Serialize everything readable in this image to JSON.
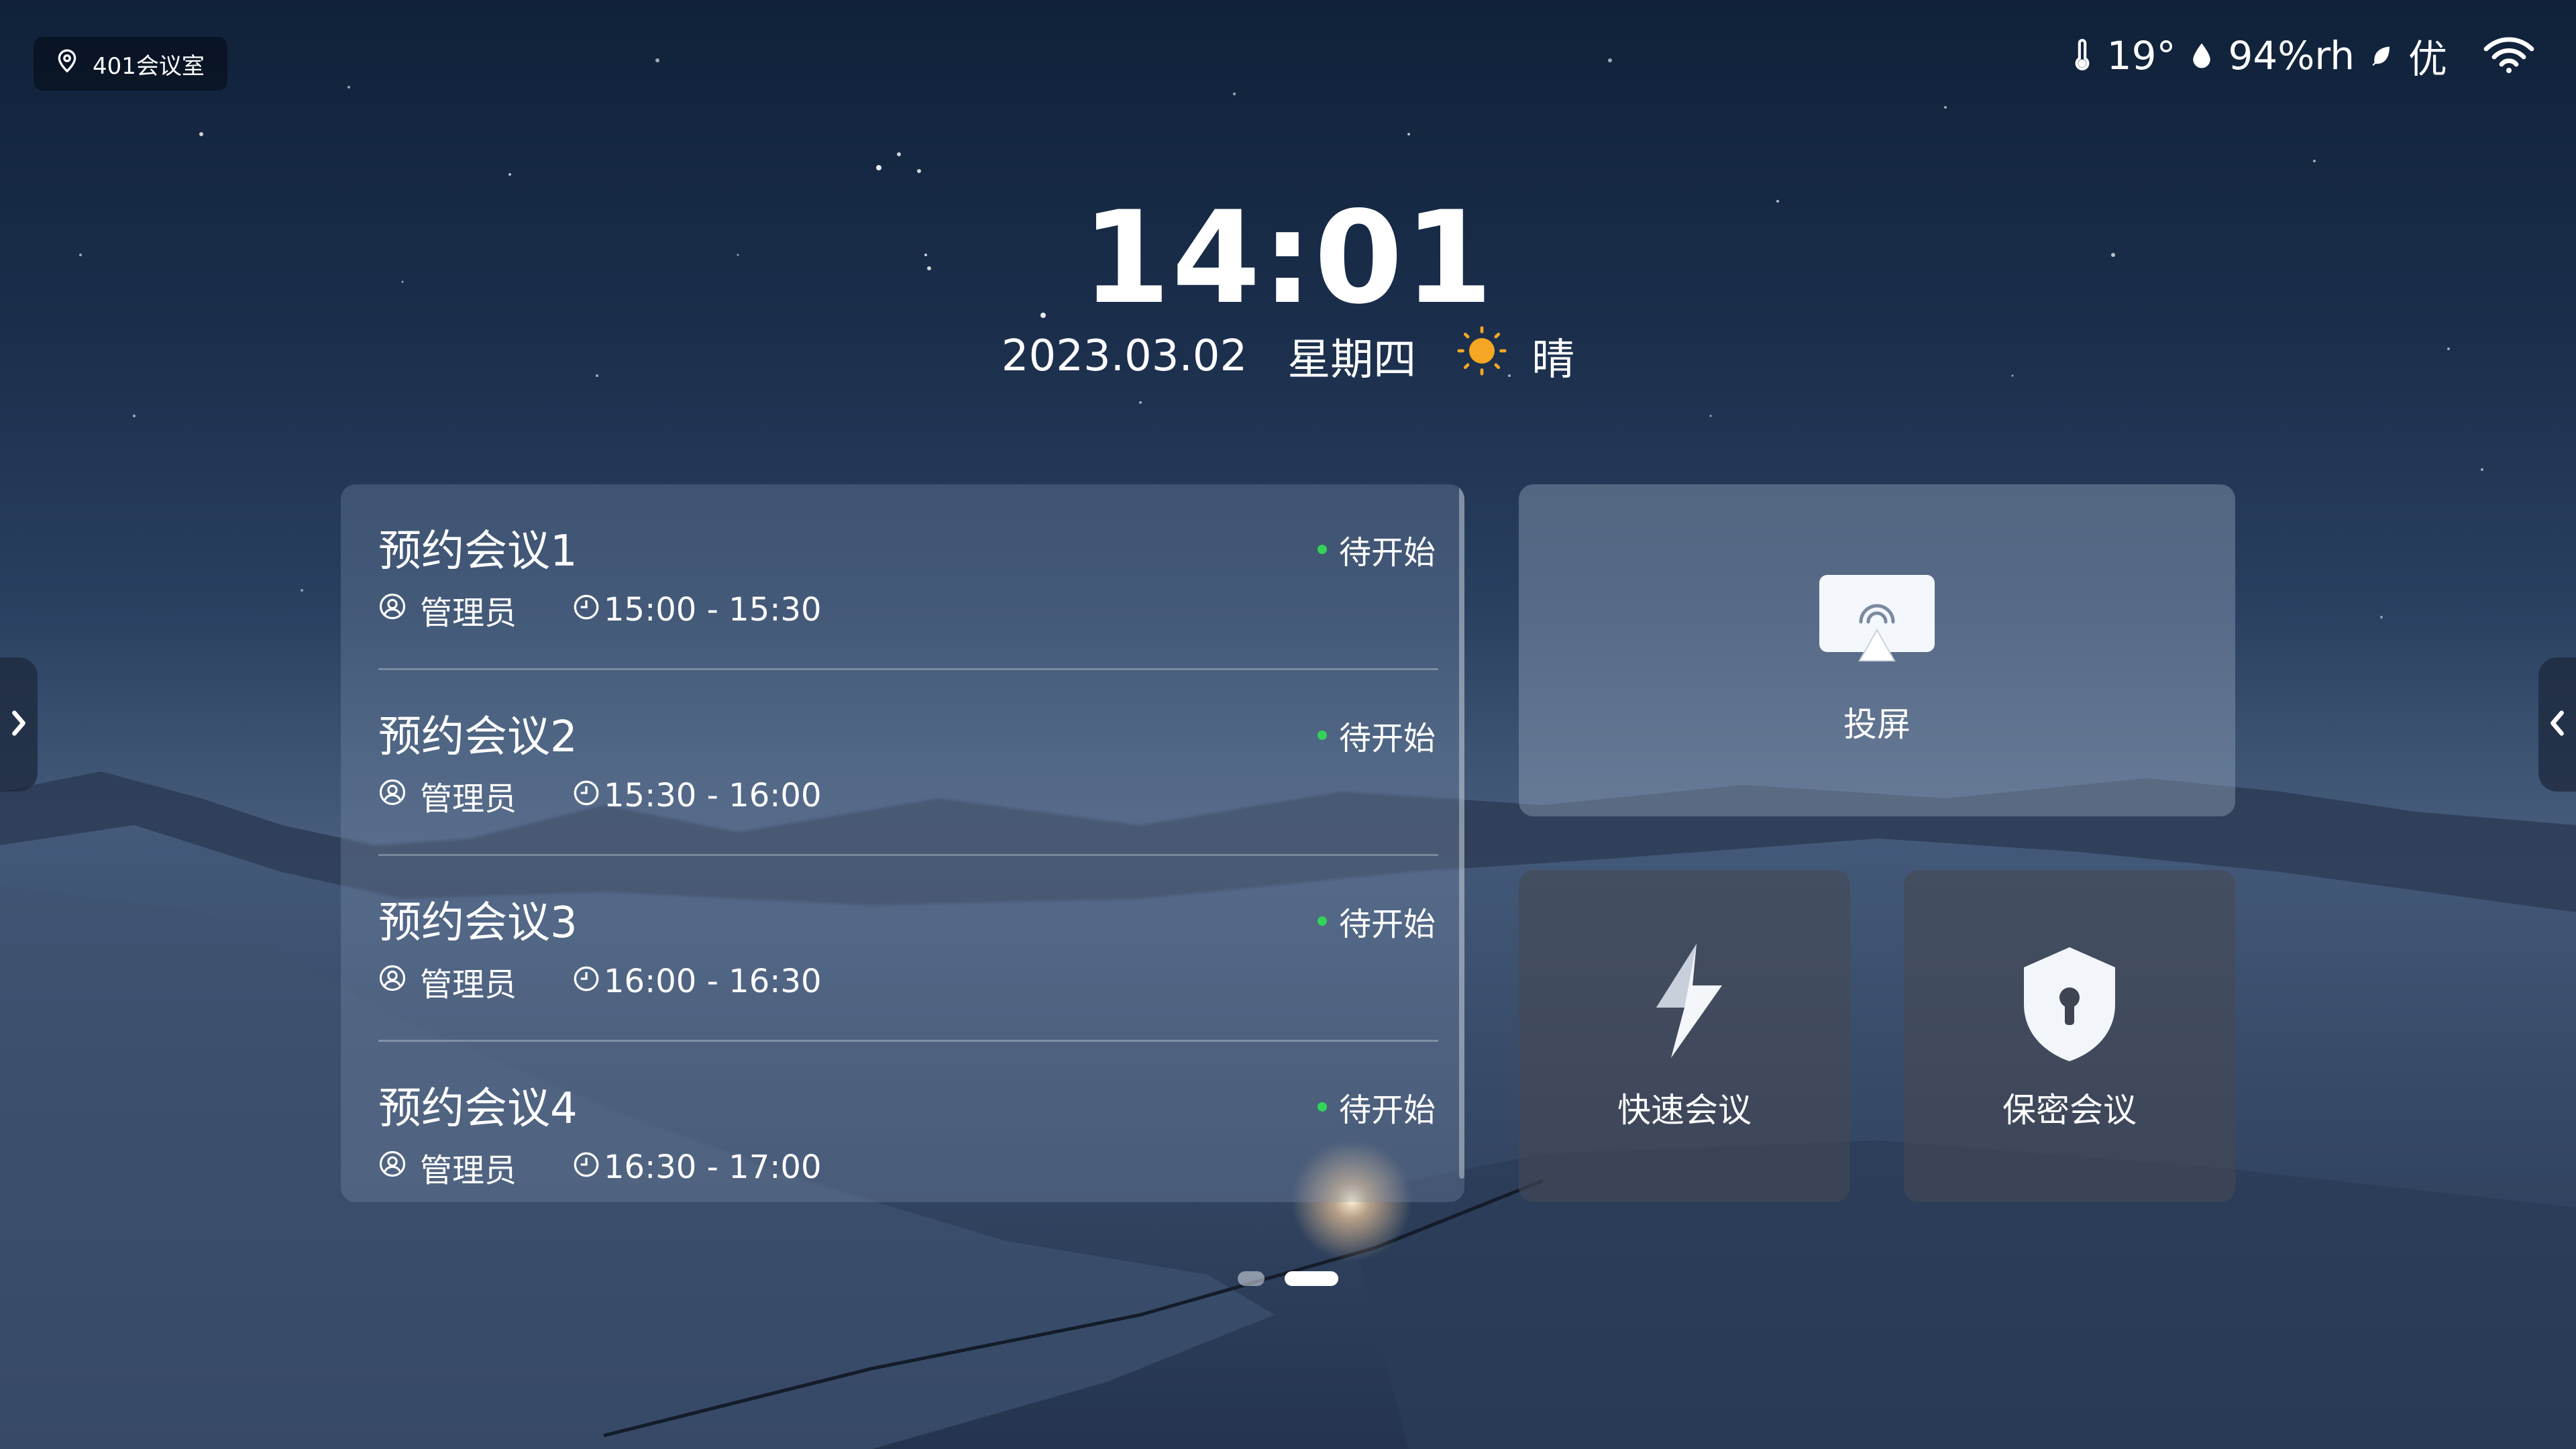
{
  "room": {
    "name": "401会议室"
  },
  "env": {
    "temperature": "19°",
    "humidity": "94%rh",
    "air_quality": "优"
  },
  "clock": {
    "time": "14:01",
    "date": "2023.03.02",
    "weekday": "星期四",
    "weather": "晴"
  },
  "meetings": [
    {
      "title": "预约会议1",
      "status": "待开始",
      "organizer": "管理员",
      "time": "15:00 - 15:30"
    },
    {
      "title": "预约会议2",
      "status": "待开始",
      "organizer": "管理员",
      "time": "15:30 - 16:00"
    },
    {
      "title": "预约会议3",
      "status": "待开始",
      "organizer": "管理员",
      "time": "16:00 - 16:30"
    },
    {
      "title": "预约会议4",
      "status": "待开始",
      "organizer": "管理员",
      "time": "16:30 - 17:00"
    }
  ],
  "actions": {
    "projection": "投屏",
    "quick_meeting": "快速会议",
    "secret_meeting": "保密会议"
  },
  "pager": {
    "pages": 2,
    "current": 2
  },
  "colors": {
    "status_dot": "#33d35a",
    "sun": "#f5a623"
  },
  "icons": [
    "location-pin-icon",
    "thermometer-icon",
    "water-drop-icon",
    "leaf-icon",
    "wifi-icon",
    "sun-icon",
    "user-icon",
    "clock-icon",
    "cast-screen-icon",
    "lightning-icon",
    "shield-lock-icon",
    "chevron-right-icon",
    "chevron-left-icon"
  ]
}
